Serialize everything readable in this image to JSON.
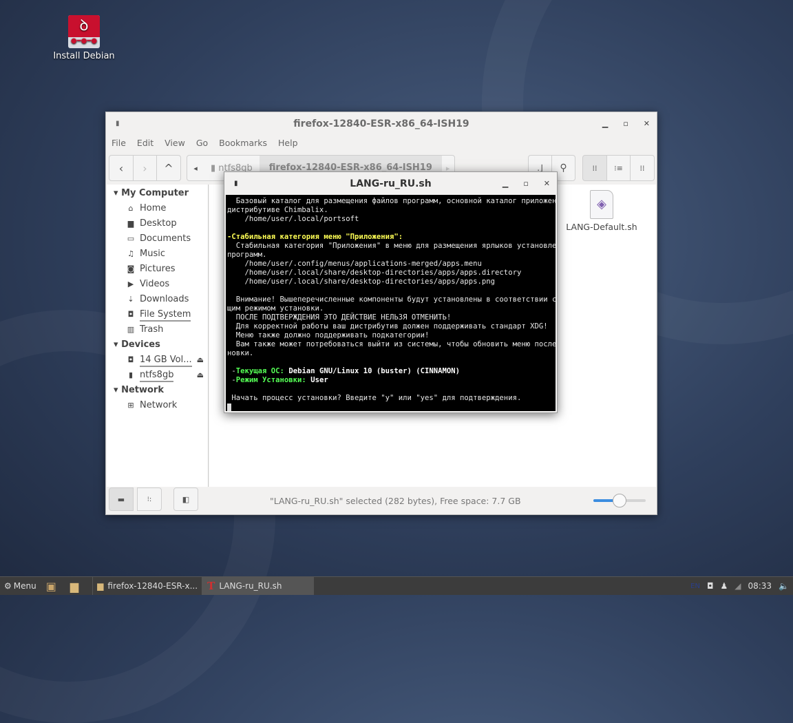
{
  "desktop": {
    "icon_label": "Install Debian"
  },
  "file_manager": {
    "title": "firefox-12840-ESR-x86_64-ISH19",
    "menu": [
      "File",
      "Edit",
      "View",
      "Go",
      "Bookmarks",
      "Help"
    ],
    "breadcrumb": [
      "ntfs8gb",
      "firefox-12840-ESR-x86_64-ISH19"
    ],
    "sidebar": {
      "sections": [
        {
          "title": "My Computer",
          "items": [
            {
              "label": "Home",
              "icon": "⌂"
            },
            {
              "label": "Desktop",
              "icon": "▆"
            },
            {
              "label": "Documents",
              "icon": "▭"
            },
            {
              "label": "Music",
              "icon": "♫"
            },
            {
              "label": "Pictures",
              "icon": "◙"
            },
            {
              "label": "Videos",
              "icon": "▶"
            },
            {
              "label": "Downloads",
              "icon": "⇣"
            },
            {
              "label": "File System",
              "icon": "◘"
            },
            {
              "label": "Trash",
              "icon": "🗑"
            }
          ]
        },
        {
          "title": "Devices",
          "items": [
            {
              "label": "14 GB Vol...",
              "icon": "◘"
            },
            {
              "label": "ntfs8gb",
              "icon": "▮"
            }
          ]
        },
        {
          "title": "Network",
          "items": [
            {
              "label": "Network",
              "icon": "⊞"
            }
          ]
        }
      ]
    },
    "files": [
      {
        "name": "LANG-Default.sh"
      }
    ],
    "status": "\"LANG-ru_RU.sh\" selected (282 bytes), Free space: 7.7 GB",
    "zoom_level": 0.5
  },
  "terminal": {
    "title": "LANG-ru_RU.sh",
    "lines": [
      [
        {
          "t": "  Базовый каталог для размещения файлов программ, основной каталог приложений в"
        }
      ],
      [
        {
          "t": "дистрибутиве Chimbalix."
        }
      ],
      [
        {
          "t": "    /home/user/.local/portsoft"
        }
      ],
      [
        {
          "t": ""
        }
      ],
      [
        {
          "t": "-Стабильная категория меню \"Приложения\":",
          "c": "yel"
        }
      ],
      [
        {
          "t": "  Стабильная категория \"Приложения\" в меню для размещения ярлыков установленных"
        }
      ],
      [
        {
          "t": "программ."
        }
      ],
      [
        {
          "t": "    /home/user/.config/menus/applications-merged/apps.menu"
        }
      ],
      [
        {
          "t": "    /home/user/.local/share/desktop-directories/apps/apps.directory"
        }
      ],
      [
        {
          "t": "    /home/user/.local/share/desktop-directories/apps/apps.png"
        }
      ],
      [
        {
          "t": ""
        }
      ],
      [
        {
          "t": "  Внимание! Вышеперечисленные компоненты будут установлены в соответствии с теку"
        }
      ],
      [
        {
          "t": "щим режимом установки."
        }
      ],
      [
        {
          "t": "  ПОСЛЕ ПОДТВЕРЖДЕНИЯ ЭТО ДЕЙСТВИЕ НЕЛЬЗЯ ОТМЕНИТЬ!"
        }
      ],
      [
        {
          "t": "  Для корректной работы ваш дистрибутив должен поддерживать стандарт XDG!"
        }
      ],
      [
        {
          "t": "  Меню также должно поддерживать подкатегории!"
        }
      ],
      [
        {
          "t": "  Вам также может потребоваться выйти из системы, чтобы обновить меню после уста"
        }
      ],
      [
        {
          "t": "новки."
        }
      ],
      [
        {
          "t": ""
        }
      ],
      [
        {
          "t": " -"
        },
        {
          "t": "Текущая ОС:",
          "c": "grn"
        },
        {
          "t": " Debian GNU/Linux 10 (buster) (CINNAMON)",
          "c": "bw"
        }
      ],
      [
        {
          "t": " -"
        },
        {
          "t": "Режим Установки:",
          "c": "grn"
        },
        {
          "t": " User",
          "c": "bw"
        }
      ],
      [
        {
          "t": ""
        }
      ],
      [
        {
          "t": " Начать процесс установки? Введите \"y\" или \"yes\" для подтверждения."
        }
      ]
    ]
  },
  "taskbar": {
    "menu_label": "Menu",
    "tasks": [
      {
        "label": "firefox-12840-ESR-x..."
      },
      {
        "label": "LANG-ru_RU.sh"
      }
    ],
    "clock": "08:33"
  }
}
